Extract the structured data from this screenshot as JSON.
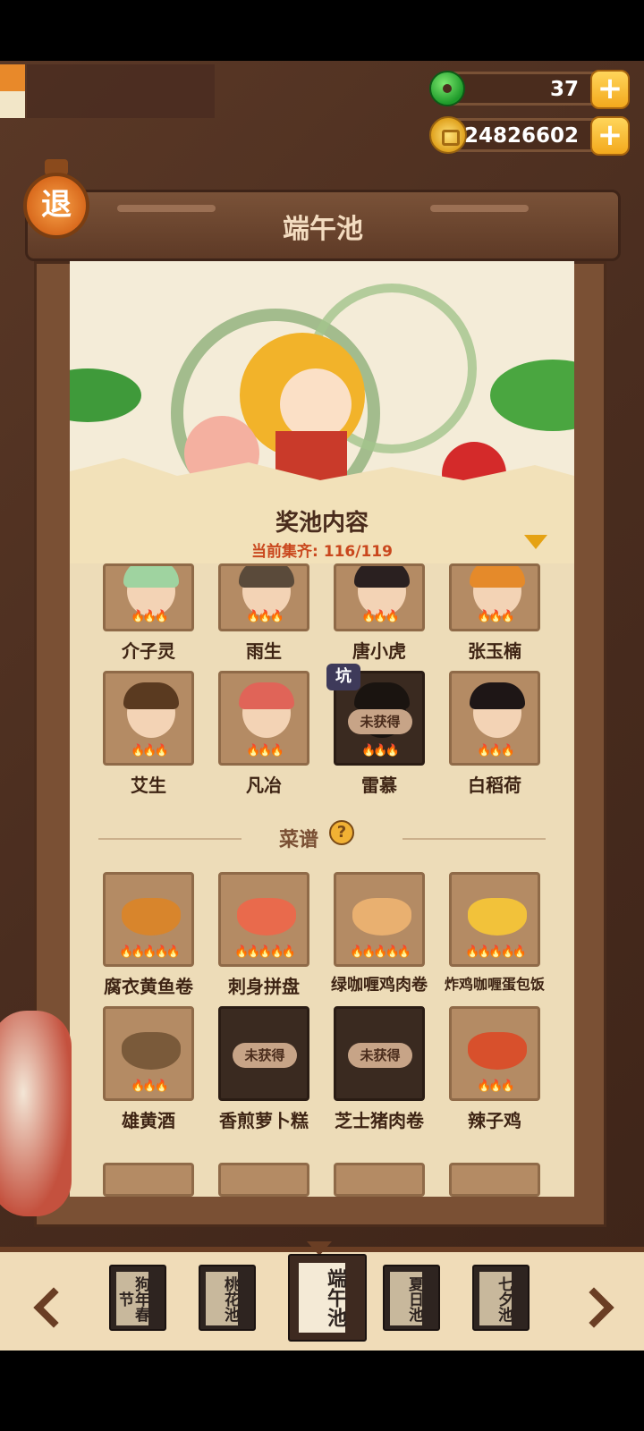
{
  "currency": {
    "jade": {
      "value": "37",
      "icon": "jade-icon"
    },
    "coins": {
      "value": "24826602",
      "icon": "coin-icon"
    }
  },
  "exit_button": {
    "label": "退"
  },
  "header": {
    "title": "端午池"
  },
  "pool": {
    "title": "奖池内容",
    "progress_label": "当前集齐: 116/119",
    "collected": 116,
    "total": 119
  },
  "characters": [
    {
      "name": "介子灵",
      "locked": false,
      "hair": "#9fd3a0"
    },
    {
      "name": "雨生",
      "locked": false,
      "hair": "#5a4a3a"
    },
    {
      "name": "唐小虎",
      "locked": false,
      "hair": "#2a2020"
    },
    {
      "name": "张玉楠",
      "locked": false,
      "hair": "#e58a2a"
    },
    {
      "name": "艾生",
      "locked": false,
      "hair": "#5a3a20"
    },
    {
      "name": "凡冶",
      "locked": false,
      "hair": "#e06458"
    },
    {
      "name": "雷慕",
      "locked": true,
      "locked_label": "未获得",
      "badge": "坑",
      "hair": "#1a1410"
    },
    {
      "name": "白稻荷",
      "locked": false,
      "hair": "#1e1616"
    }
  ],
  "recipes_section": {
    "label": "菜谱",
    "help_icon": "question-icon"
  },
  "recipes": [
    {
      "name": "腐衣黄鱼卷",
      "locked": false,
      "color": "#d8852c"
    },
    {
      "name": "刺身拼盘",
      "locked": false,
      "color": "#e96a4c"
    },
    {
      "name": "绿咖喱鸡肉卷",
      "locked": false,
      "color": "#e9b070"
    },
    {
      "name": "炸鸡咖喱蛋包饭",
      "locked": false,
      "color": "#f2c23a"
    },
    {
      "name": "雄黄酒",
      "locked": false,
      "color": "#7a5a3a"
    },
    {
      "name": "香煎萝卜糕",
      "locked": true,
      "locked_label": "未获得",
      "color": "#3a2a20"
    },
    {
      "name": "芝士猪肉卷",
      "locked": true,
      "locked_label": "未获得",
      "color": "#3a2a20"
    },
    {
      "name": "辣子鸡",
      "locked": false,
      "color": "#d8502c"
    }
  ],
  "tabs": [
    {
      "label": "狗年春节",
      "active": false
    },
    {
      "label": "桃花池",
      "active": false
    },
    {
      "label": "端午池",
      "active": true
    },
    {
      "label": "夏日池",
      "active": false
    },
    {
      "label": "七夕池",
      "active": false
    }
  ]
}
